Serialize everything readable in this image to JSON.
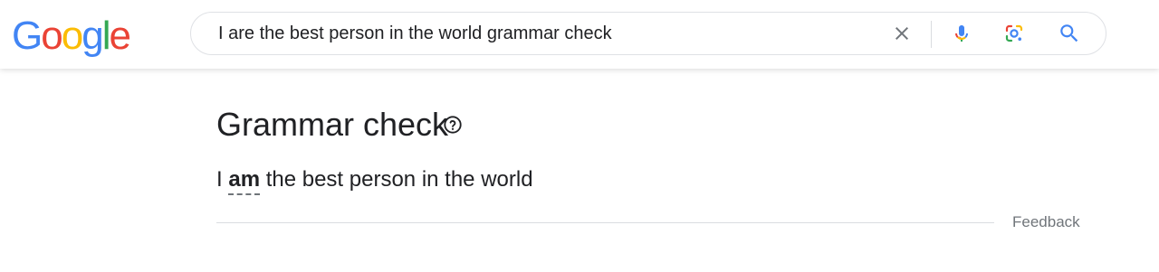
{
  "header": {
    "logo": {
      "letters": [
        "G",
        "o",
        "o",
        "g",
        "l",
        "e"
      ],
      "colors": [
        "#4285F4",
        "#EA4335",
        "#FBBC05",
        "#4285F4",
        "#34A853",
        "#EA4335"
      ]
    },
    "search": {
      "value": "I are the best person in the world grammar check",
      "icons": [
        "close-icon",
        "microphone-icon",
        "camera-lens-icon",
        "search-icon"
      ]
    }
  },
  "grammar_card": {
    "title": "Grammar check",
    "help_icon": "question-circle-icon",
    "corrected": {
      "before": "I ",
      "correction": "am",
      "after": " the best person in the world"
    },
    "feedback_label": "Feedback"
  },
  "colors": {
    "text": "#202124",
    "muted": "#70757a",
    "divider": "#dadce0",
    "accent_blue": "#4285F4"
  }
}
